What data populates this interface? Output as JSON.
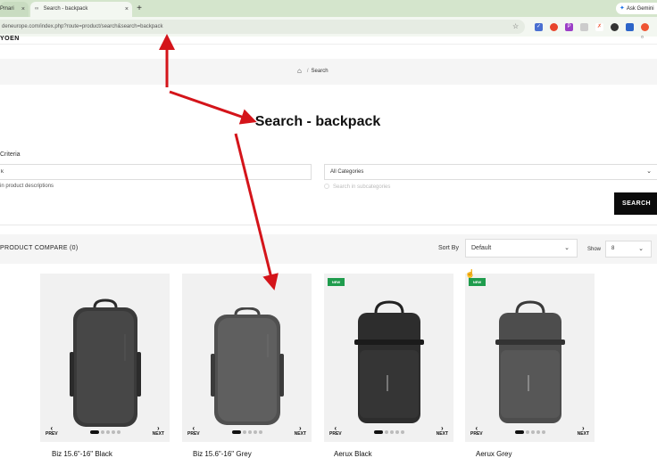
{
  "browser": {
    "tabs": [
      {
        "label": "Pmari",
        "active": false
      },
      {
        "label": "Search - backpack",
        "active": true
      }
    ],
    "new_tab_label": "+",
    "gemini_label": "Ask Gemini",
    "url": "deneurope.com/index.php?route=product/search&search=backpack",
    "close_glyph": "×"
  },
  "site": {
    "logo": "YOEN"
  },
  "breadcrumb": {
    "current": "Search",
    "separator": "/"
  },
  "page_title": "Search - backpack",
  "search_form": {
    "criteria_label": "Criteria",
    "keyword_value": "k",
    "description_label": "in product descriptions",
    "category_value": "All Categories",
    "subcategory_label": "Search in subcategories",
    "submit_label": "SEARCH"
  },
  "sort_bar": {
    "compare_label": "PRODUCT COMPARE (0)",
    "sort_label": "Sort By",
    "sort_value": "Default",
    "show_label": "Show",
    "show_value": "8"
  },
  "products": [
    {
      "name": "Biz 15.6\"-16\" Black",
      "badge": "",
      "prev": "PREV",
      "next": "NEXT"
    },
    {
      "name": "Biz 15.6\"-16\" Grey",
      "badge": "",
      "prev": "PREV",
      "next": "NEXT"
    },
    {
      "name": "Aerux Black",
      "badge": "NEW",
      "prev": "PREV",
      "next": "NEXT"
    },
    {
      "name": "Aerux Grey",
      "badge": "NEW",
      "prev": "PREV",
      "next": "NEXT"
    }
  ],
  "colors": {
    "accent_button": "#0b0b0b",
    "badge_new": "#1f9c4d",
    "annotation_arrow": "#d4141a"
  }
}
